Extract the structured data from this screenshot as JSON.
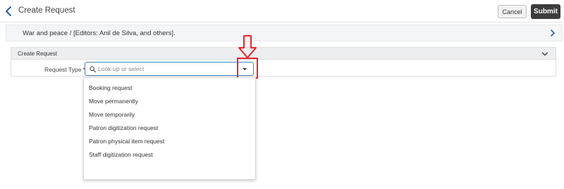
{
  "header": {
    "title": "Create Request",
    "cancel_label": "Cancel",
    "submit_label": "Submit"
  },
  "record": {
    "title": "War and peace / [Editors: Anil de Silva, and others]."
  },
  "section": {
    "title": "Create Request"
  },
  "request_type": {
    "label": "Request Type",
    "required_marker": "*",
    "placeholder": "Look-up or select",
    "value": ""
  },
  "dropdown": {
    "options": [
      "Booking request",
      "Move permanently",
      "Move temporarily",
      "Patron digitization request",
      "Patron physical item request",
      "Staff digitization request"
    ]
  },
  "colors": {
    "accent": "#2b5f9e",
    "field_border": "#4a82b8",
    "submit_bg": "#3c3c3c",
    "callout": "#e8252b",
    "required": "#d0021b"
  },
  "icons": [
    "back-chevron-icon",
    "chevron-right-icon",
    "chevron-down-icon",
    "search-icon",
    "caret-down-icon",
    "down-arrow-icon"
  ]
}
